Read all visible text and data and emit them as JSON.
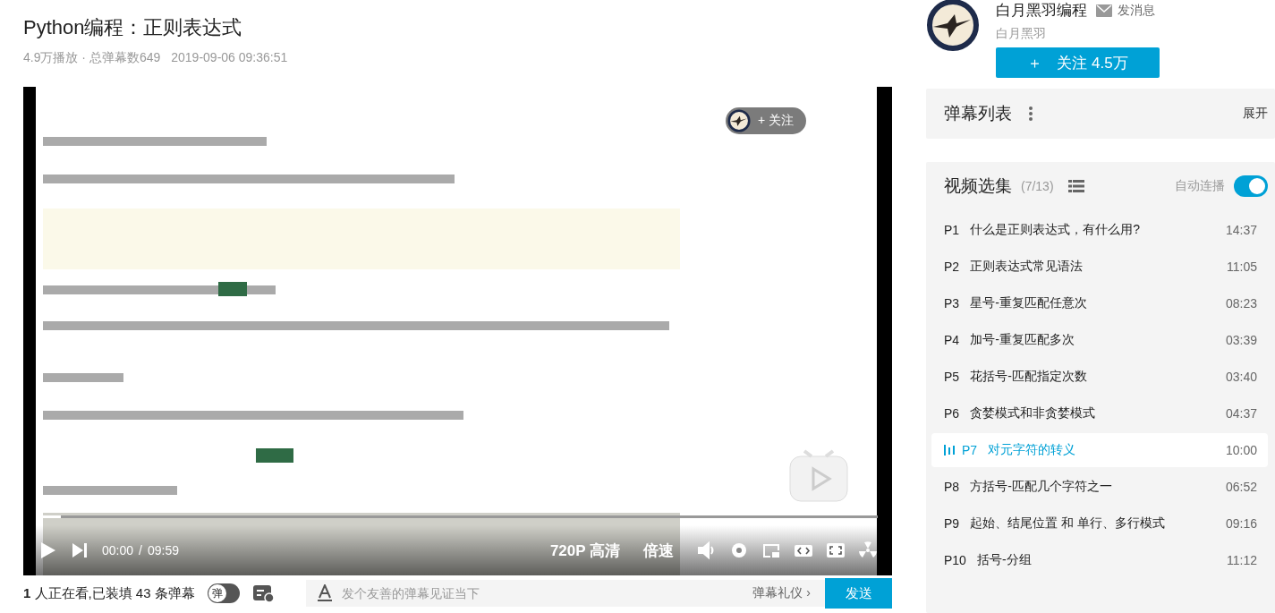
{
  "video": {
    "title": "Python编程：正则表达式",
    "plays": "4.9万播放 · 总弹幕数649",
    "date": "2019-09-06 09:36:51",
    "follow_overlay": "+ 关注",
    "time_current": "00:00",
    "time_separator": "/",
    "time_total": "09:59",
    "quality": "720P 高清",
    "speed": "倍速",
    "progress": {
      "level": 0.03
    }
  },
  "uploader": {
    "name": "白月黑羽编程",
    "message": "发消息",
    "subtitle": "白月黑羽",
    "follow_icon": "＋",
    "follow": "关注 4.5万"
  },
  "danmaku_list": {
    "title": "弹幕列表",
    "expand": "展开"
  },
  "playlist": {
    "title": "视频选集",
    "count": "(7/13)",
    "autoplay_label": "自动连播",
    "autoplay": true,
    "items": [
      {
        "part": "P1",
        "title": "什么是正则表达式，有什么用?",
        "duration": "14:37",
        "selected": false
      },
      {
        "part": "P2",
        "title": "正则表达式常见语法",
        "duration": "11:05",
        "selected": false
      },
      {
        "part": "P3",
        "title": "星号-重复匹配任意次",
        "duration": "08:23",
        "selected": false
      },
      {
        "part": "P4",
        "title": "加号-重复匹配多次",
        "duration": "03:39",
        "selected": false
      },
      {
        "part": "P5",
        "title": "花括号-匹配指定次数",
        "duration": "03:40",
        "selected": false
      },
      {
        "part": "P6",
        "title": "贪婪模式和非贪婪模式",
        "duration": "04:37",
        "selected": false
      },
      {
        "part": "P7",
        "title": "对元字符的转义",
        "duration": "10:00",
        "selected": true
      },
      {
        "part": "P8",
        "title": "方括号-匹配几个字符之一",
        "duration": "06:52",
        "selected": false
      },
      {
        "part": "P9",
        "title": "起始、结尾位置 和 单行、多行模式",
        "duration": "09:16",
        "selected": false
      },
      {
        "part": "P10",
        "title": "括号-分组",
        "duration": "11:12",
        "selected": false
      }
    ]
  },
  "danmaku_bar": {
    "viewers": "1",
    "viewers_text": "人正在看,已装填 43 条弹幕",
    "toggle": "弹",
    "danmaku_on": false,
    "placeholder": "发个友善的弹幕见证当下",
    "etiquette": "弹幕礼仪",
    "etiquette_arrow": "›",
    "send": "发送"
  }
}
